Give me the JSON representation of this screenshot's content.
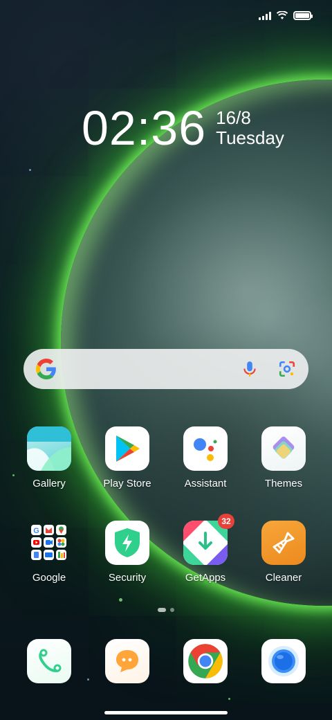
{
  "status_bar": {
    "signal": "signal-icon",
    "wifi": "wifi-icon",
    "battery": "battery-icon",
    "battery_level": 1.0
  },
  "clock": {
    "time": "02:36",
    "date": "16/8",
    "weekday": "Tuesday"
  },
  "search": {
    "logo": "google-g-icon",
    "mic": "mic-icon",
    "lens": "google-lens-icon"
  },
  "apps_row1": [
    {
      "label": "Gallery",
      "icon": "gallery-icon"
    },
    {
      "label": "Play Store",
      "icon": "play-store-icon"
    },
    {
      "label": "Assistant",
      "icon": "assistant-icon"
    },
    {
      "label": "Themes",
      "icon": "themes-icon"
    }
  ],
  "apps_row2": [
    {
      "label": "Google",
      "icon": "google-folder-icon"
    },
    {
      "label": "Security",
      "icon": "security-icon"
    },
    {
      "label": "GetApps",
      "icon": "getapps-icon",
      "badge": "32"
    },
    {
      "label": "Cleaner",
      "icon": "cleaner-icon"
    }
  ],
  "dock": [
    {
      "icon": "phone-icon"
    },
    {
      "icon": "messages-icon"
    },
    {
      "icon": "chrome-icon"
    },
    {
      "icon": "browser-icon"
    }
  ],
  "page_indicator": {
    "current": 1,
    "total": 2
  },
  "colors": {
    "planet_glow": "#5fe04a",
    "badge": "#e8413c",
    "accent_orange": "#f0962a"
  }
}
